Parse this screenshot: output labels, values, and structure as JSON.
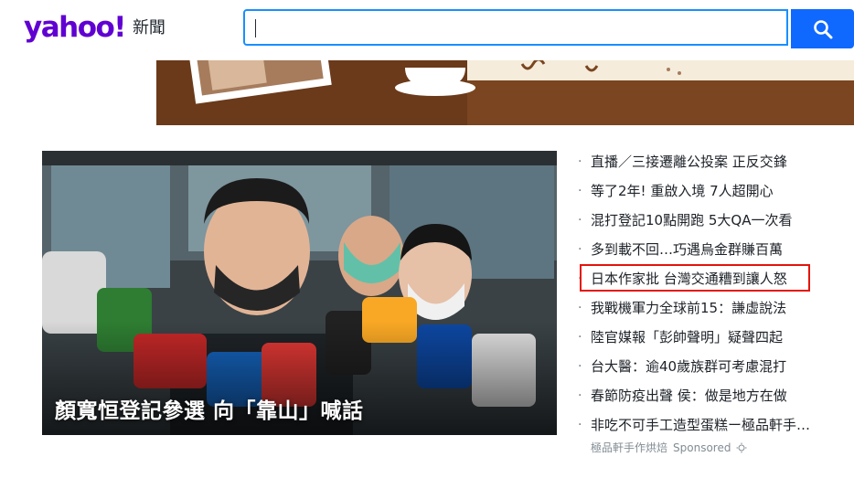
{
  "header": {
    "logo_text": "yahoo!",
    "section_label": "新聞",
    "search": {
      "value": "",
      "placeholder": ""
    }
  },
  "hero": {
    "title": "顏寬恒登記參選 向「靠山」喊話"
  },
  "headlines": [
    {
      "text": "直播／三接遷離公投案 正反交鋒"
    },
    {
      "text": "等了2年! 重啟入境 7人超開心"
    },
    {
      "text": "混打登記10點開跑 5大QA一次看"
    },
    {
      "text": "多到載不回…巧遇烏金群賺百萬"
    },
    {
      "text": "日本作家批 台灣交通糟到讓人怒"
    },
    {
      "text": "我戰機軍力全球前15：謙虛說法"
    },
    {
      "text": "陸官媒報「彭帥聲明」疑聲四起"
    },
    {
      "text": "台大醫：逾40歲族群可考慮混打"
    },
    {
      "text": "春節防疫出聲 侯：做是地方在做"
    },
    {
      "text": "非吃不可手工造型蛋糕ー極品軒手…"
    }
  ],
  "sponsor": {
    "advertiser": "極品軒手作烘焙",
    "label": "Sponsored"
  },
  "colors": {
    "brand": "#6001d2",
    "search_border": "#188fff",
    "search_button": "#0f69ff",
    "highlight": "#e3140c"
  },
  "icons": {
    "search": "search-icon",
    "sponsor": "sponsored-info-icon"
  }
}
